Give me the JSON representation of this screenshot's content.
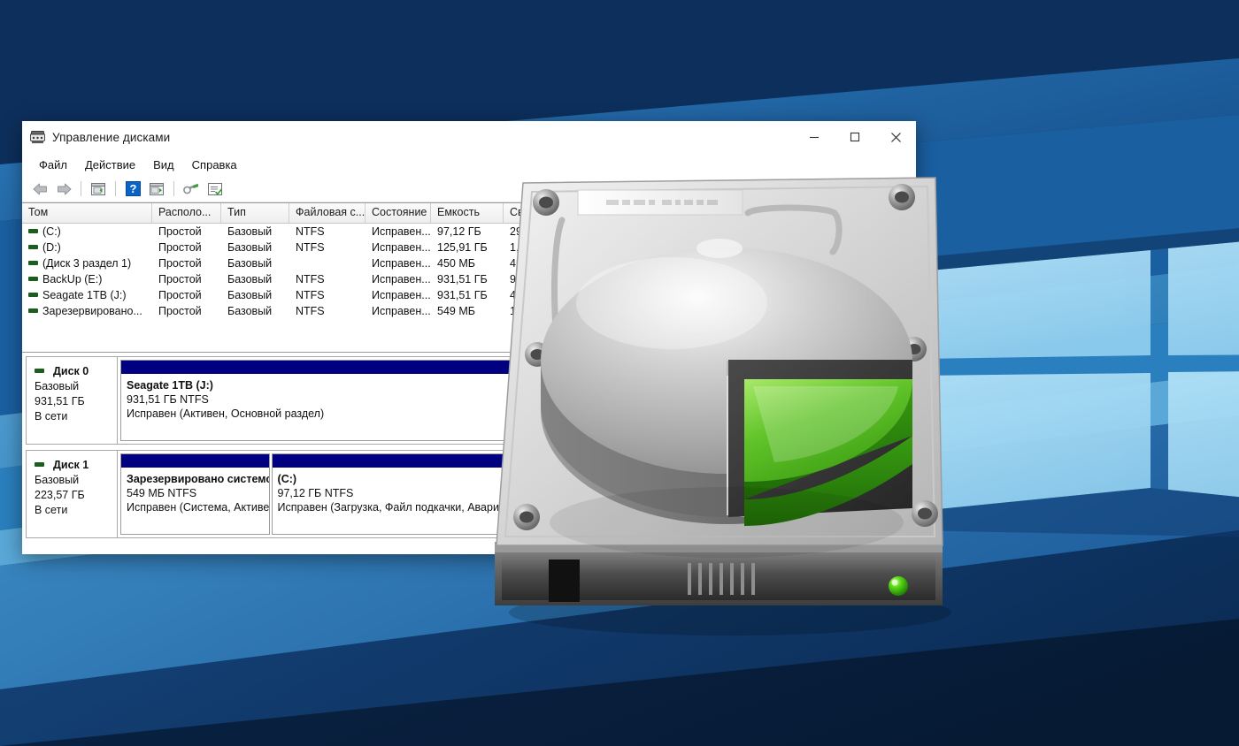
{
  "window": {
    "title": "Управление дисками",
    "icon": "disk-management-icon",
    "controls": {
      "minimize": "minimize-icon",
      "maximize": "maximize-icon",
      "close": "close-icon"
    }
  },
  "menubar": {
    "items": [
      {
        "label": "Файл"
      },
      {
        "label": "Действие"
      },
      {
        "label": "Вид"
      },
      {
        "label": "Справка"
      }
    ]
  },
  "toolbar": {
    "buttons": [
      {
        "name": "back-arrow-icon",
        "title": "Назад"
      },
      {
        "name": "forward-arrow-icon",
        "title": "Вперед"
      },
      {
        "name": "up-folder-icon",
        "title": "Вверх"
      },
      {
        "name": "help-icon",
        "title": "Справка"
      },
      {
        "name": "show-pane-icon",
        "title": "Показать область"
      },
      {
        "name": "rescan-icon",
        "title": "Повторить проверку дисков"
      },
      {
        "name": "properties-icon",
        "title": "Свойства"
      }
    ]
  },
  "volume_list": {
    "columns": [
      {
        "label": "Том"
      },
      {
        "label": "Располо..."
      },
      {
        "label": "Тип"
      },
      {
        "label": "Файловая с..."
      },
      {
        "label": "Состояние"
      },
      {
        "label": "Емкость"
      },
      {
        "label": "Сво"
      }
    ],
    "rows": [
      {
        "volume": "(C:)",
        "layout": "Простой",
        "type": "Базовый",
        "fs": "NTFS",
        "status": "Исправен...",
        "capacity": "97,12 ГБ",
        "free": "29,"
      },
      {
        "volume": "(D:)",
        "layout": "Простой",
        "type": "Базовый",
        "fs": "NTFS",
        "status": "Исправен...",
        "capacity": "125,91 ГБ",
        "free": "1,6"
      },
      {
        "volume": "(Диск 3 раздел 1)",
        "layout": "Простой",
        "type": "Базовый",
        "fs": "",
        "status": "Исправен...",
        "capacity": "450 МБ",
        "free": "45"
      },
      {
        "volume": "BackUp (E:)",
        "layout": "Простой",
        "type": "Базовый",
        "fs": "NTFS",
        "status": "Исправен...",
        "capacity": "931,51 ГБ",
        "free": "92"
      },
      {
        "volume": "Seagate 1TB (J:)",
        "layout": "Простой",
        "type": "Базовый",
        "fs": "NTFS",
        "status": "Исправен...",
        "capacity": "931,51 ГБ",
        "free": "4ƒ"
      },
      {
        "volume": "Зарезервировано...",
        "layout": "Простой",
        "type": "Базовый",
        "fs": "NTFS",
        "status": "Исправен...",
        "capacity": "549 МБ",
        "free": "1"
      }
    ]
  },
  "disks": [
    {
      "name": "Диск 0",
      "type": "Базовый",
      "size": "931,51 ГБ",
      "state": "В сети",
      "partitions": [
        {
          "label": "Seagate 1TB  (J:)",
          "size": "931,51 ГБ NTFS",
          "status": "Исправен (Активен, Основной раздел)",
          "width_pct": 100
        }
      ]
    },
    {
      "name": "Диск 1",
      "type": "Базовый",
      "size": "223,57 ГБ",
      "state": "В сети",
      "partitions": [
        {
          "label": "Зарезервировано системс",
          "size": "549 МБ NTFS",
          "status": "Исправен (Система, Активе",
          "width_pct": 19
        },
        {
          "label": "(C:)",
          "size": "97,12 ГБ NTFS",
          "status": "Исправен (Загрузка, Файл подкачки, Аварий",
          "width_pct": 81
        }
      ]
    }
  ],
  "illustration": {
    "name": "hard-disk-drive-image",
    "label_sticker_text": "",
    "led_color": "#2ecc11",
    "pie_slice_color": "#4fc21c",
    "platter_color": "#c8c8c8"
  },
  "wallpaper": {
    "name": "windows-10-hero-wallpaper",
    "colors": {
      "dark_navy": "#0a2240",
      "mid_blue": "#1d5fa4",
      "deep_blue": "#123d72",
      "light_blue": "#4e9ed4",
      "pale_blue": "#9ed7f2",
      "logo_blue": "#9fd6f2"
    }
  }
}
